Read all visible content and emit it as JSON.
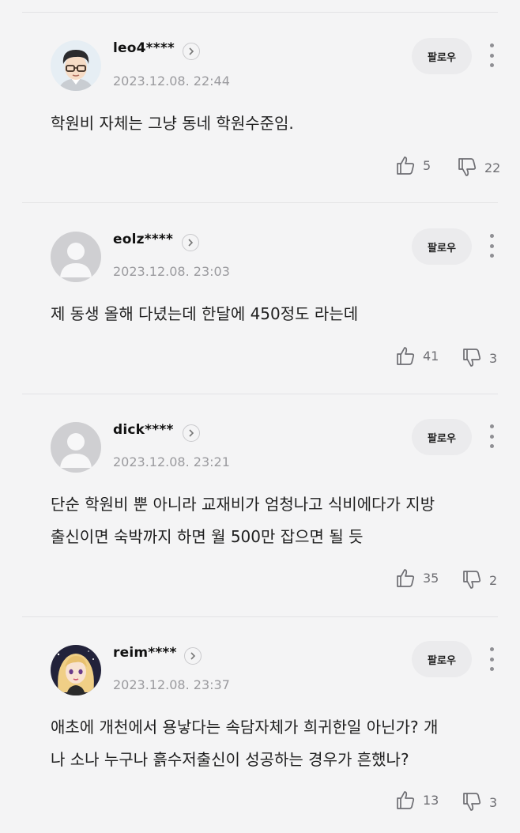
{
  "follow_label": "팔로우",
  "comments": [
    {
      "username": "leo4****",
      "timestamp": "2023.12.08. 22:44",
      "text": "학원비 자체는 그냥 동네 학원수준임.",
      "likes": "5",
      "dislikes": "22",
      "avatar": "cartoon-man-glasses"
    },
    {
      "username": "eolz****",
      "timestamp": "2023.12.08. 23:03",
      "text": "제 동생 올해 다녔는데 한달에 450정도 라는데",
      "likes": "41",
      "dislikes": "3",
      "avatar": "default-person"
    },
    {
      "username": "dick****",
      "timestamp": "2023.12.08. 23:21",
      "text": "단순 학원비 뿐 아니라 교재비가 엄청나고 식비에다가 지방\n출신이면 숙박까지 하면 월 500만 잡으면 될 듯",
      "likes": "35",
      "dislikes": "2",
      "avatar": "default-person"
    },
    {
      "username": "reim****",
      "timestamp": "2023.12.08. 23:37",
      "text": "애초에 개천에서 용낳다는 속담자체가 희귀한일 아닌가? 개\n나 소나 누구나 흙수저출신이 성공하는 경우가 흔했나?",
      "likes": "13",
      "dislikes": "3",
      "avatar": "cartoon-woman-blonde"
    }
  ]
}
